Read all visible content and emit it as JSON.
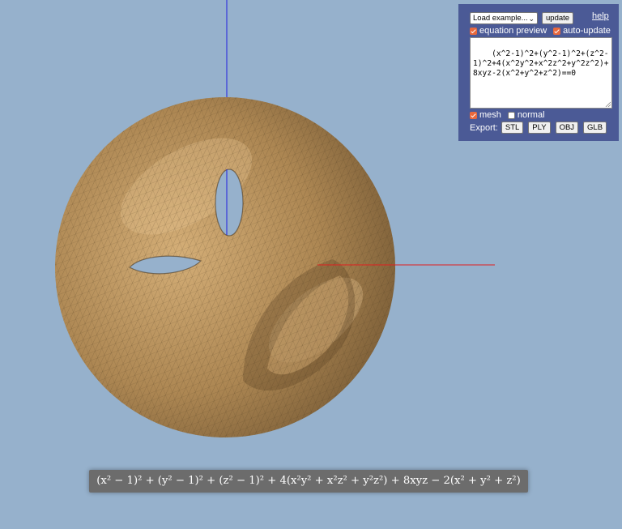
{
  "panel": {
    "load_example": "Load example...",
    "update_label": "update",
    "help_label": "help",
    "equation_preview_label": "equation preview",
    "equation_preview_checked": true,
    "auto_update_label": "auto-update",
    "auto_update_checked": true,
    "equation_text": "(x^2-1)^2+(y^2-1)^2+(z^2-1)^2+4(x^2y^2+x^2z^2+y^2z^2)+8xyz-2(x^2+y^2+z^2)==0",
    "mesh_label": "mesh",
    "mesh_checked": true,
    "normal_label": "normal",
    "normal_checked": false,
    "export_label": "Export:",
    "export_buttons": [
      "STL",
      "PLY",
      "OBJ",
      "GLB"
    ]
  },
  "equation_rendered": "(x² − 1)² + (y² − 1)² + (z² − 1)² + 4(x²y² + x²z² + y²z²) + 8xyz − 2(x² + y² + z²)",
  "colors": {
    "background": "#96b1cc",
    "panel": "#4b5a96",
    "surface": "#b48e5c",
    "x_axis": "#e02020",
    "y_axis": "#2020e0",
    "checkbox_accent": "#e8683c"
  }
}
